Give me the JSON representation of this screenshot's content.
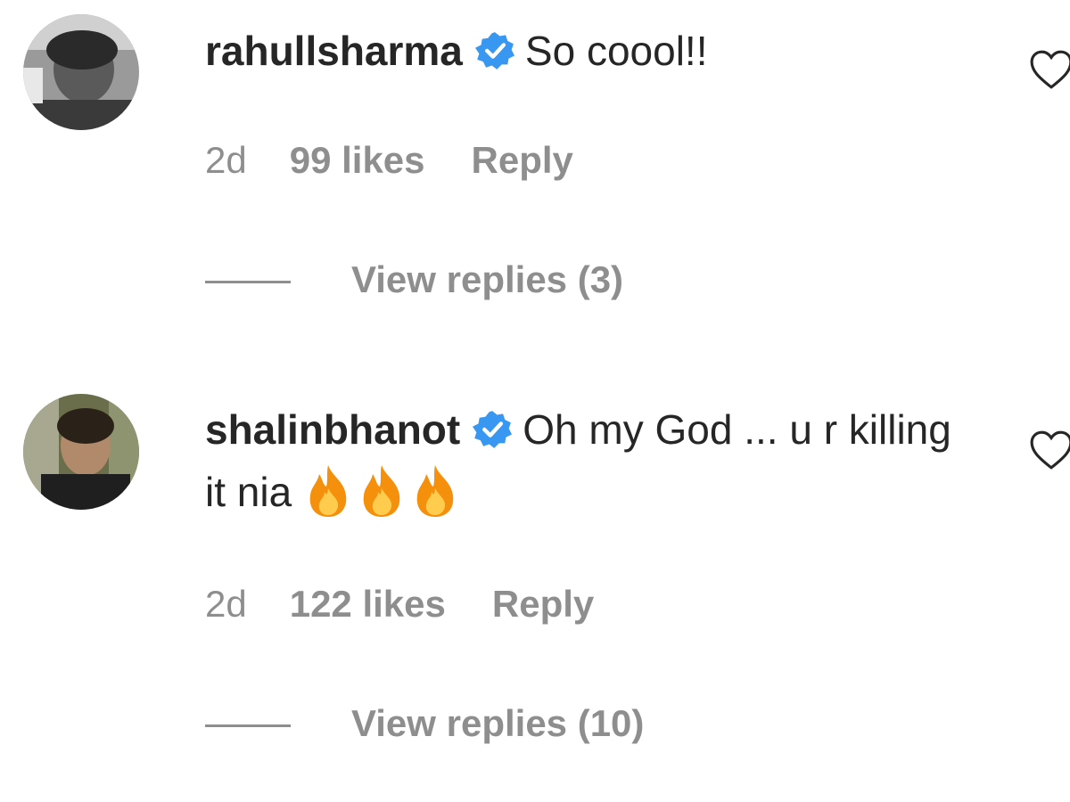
{
  "comments": [
    {
      "username": "rahullsharma",
      "text": "So coool!!",
      "time": "2d",
      "likes": "99 likes",
      "reply": "Reply",
      "view_replies": "View replies (3)",
      "verified": true,
      "avatar_icon": "avatar-grayscale-photo"
    },
    {
      "username": "shalinbhanot",
      "text": "Oh my God ... u r killing it nia",
      "time": "2d",
      "likes": "122 likes",
      "reply": "Reply",
      "view_replies": "View replies (10)",
      "verified": true,
      "emoji": "🔥🔥🔥",
      "avatar_icon": "avatar-color-photo"
    }
  ],
  "colors": {
    "text": "#262626",
    "secondary": "#8e8e8e",
    "verified_badge": "#3897f0",
    "fire_outer": "#f4900c",
    "fire_inner": "#ffcc4d"
  },
  "icons": {
    "verified": "verified-badge-icon",
    "like": "heart-outline-icon",
    "emoji": "fire-emoji-icon"
  }
}
